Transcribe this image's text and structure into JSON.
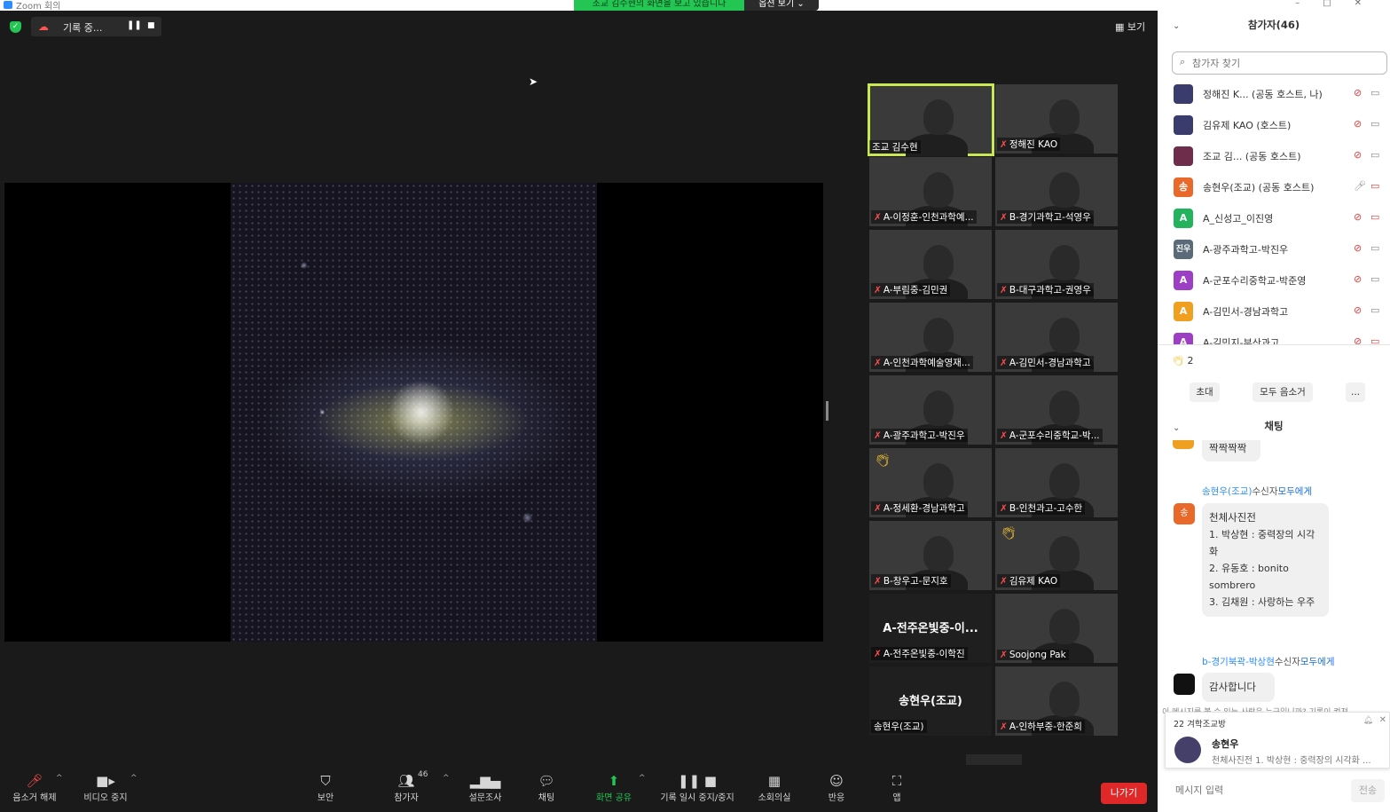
{
  "window": {
    "app_title": "Zoom 회의",
    "share_banner": "조교 김수현의 화면을 보고 있습니다",
    "view_options": "옵션 보기 ⌄"
  },
  "meeting": {
    "recording_label": "기록 중...",
    "view_label": "보기"
  },
  "gallery": {
    "tiles": [
      {
        "name": "조교 김수현",
        "muted": false
      },
      {
        "name": "정해진 KAO",
        "muted": true
      },
      {
        "name": "A-이정훈-인천과학예...",
        "muted": true
      },
      {
        "name": "B-경기과학고-석영우",
        "muted": true
      },
      {
        "name": "A-부림중-김민권",
        "muted": true
      },
      {
        "name": "B-대구과학고-권영우",
        "muted": true
      },
      {
        "name": "A-인천과학예술영재...",
        "muted": true
      },
      {
        "name": "A-김민서-경남과학고",
        "muted": true
      },
      {
        "name": "A-광주과학고-박진우",
        "muted": true
      },
      {
        "name": "A-군포수리중학교-박...",
        "muted": true
      },
      {
        "name": "A-정세환-경남과학고",
        "muted": true
      },
      {
        "name": "B-인천과고-고수한",
        "muted": true
      },
      {
        "name": "B-창우고-문지호",
        "muted": true
      },
      {
        "name": "김유제 KAO",
        "muted": true
      },
      {
        "name": "A-전주온빛중-이학진",
        "muted": true,
        "big": "A-전주온빛중-이..."
      },
      {
        "name": "Soojong Pak",
        "muted": true
      },
      {
        "name": "송현우(조교)",
        "muted": false,
        "big": "송현우(조교)"
      },
      {
        "name": "A-인하부중-한준희",
        "muted": true
      }
    ]
  },
  "toolbar": {
    "unmute": "음소거 해제",
    "video": "비디오 중지",
    "security": "보안",
    "participants": "참가자",
    "participants_count": "46",
    "polls": "설문조사",
    "chat": "채팅",
    "share": "화면 공유",
    "record": "기록 일시 중지/중지",
    "breakout": "소회의실",
    "reactions": "반응",
    "apps": "앱",
    "leave": "나가기"
  },
  "panel": {
    "participants_title": "참가자(46)",
    "search_placeholder": "참가자 찾기",
    "participants": [
      {
        "name": "정해진 K...  (공동 호스트, 나)",
        "avatar": "",
        "color": "#3a3c6e"
      },
      {
        "name": "김유제 KAO (호스트)",
        "avatar": "",
        "color": "#3a3c6e"
      },
      {
        "name": "조교 김...  (공동 호스트)",
        "avatar": "",
        "color": "#6e2d4a"
      },
      {
        "name": "송현우(조교) (공동 호스트)",
        "avatar": "송",
        "color": "#e8692a"
      },
      {
        "name": "A_신성고_이진영",
        "avatar": "A",
        "color": "#23b35c"
      },
      {
        "name": "A-광주과학고-박진우",
        "avatar": "진우",
        "color": "#5a6a78"
      },
      {
        "name": "A-군포수리중학교-박준영",
        "avatar": "A",
        "color": "#9d3fc4"
      },
      {
        "name": "A-김민서-경남과학고",
        "avatar": "A",
        "color": "#f0a020"
      },
      {
        "name": "A-김민지-부산과고",
        "avatar": "A",
        "color": "#9d3fc4"
      }
    ],
    "reaction_count": "2",
    "invite": "초대",
    "mute_all": "모두 음소거",
    "more": "...",
    "chat_title": "채팅",
    "chat": {
      "partial_bubble": "짝짝짝짝",
      "msg1_sender": "송현우(조교)",
      "msg1_to_label": "수신자",
      "msg1_to": "모두에게",
      "msg1_avatar": "송",
      "msg1_lines": [
        "천체사진전",
        "1. 박상현 : 중력장의 시각화",
        "2. 유동호 : bonito sombrero",
        "3. 김채원 : 사랑하는 우주"
      ],
      "msg2_sender": "b-경기북곽-박상현",
      "msg2_to_label": "수신자",
      "msg2_to": "모두에게",
      "msg2_text": "감사합니다"
    },
    "notice": "이 메시지를 볼 수 있는 사람은 누구입니까? 기록이 켜져...",
    "popup_title": "22 겨학조교방",
    "popup_sender": "송현우",
    "popup_msg": "천체사진전 1. 박상현 : 중력장의 시각화 ...",
    "message_placeholder": "메시지 입력",
    "send": "전송"
  }
}
